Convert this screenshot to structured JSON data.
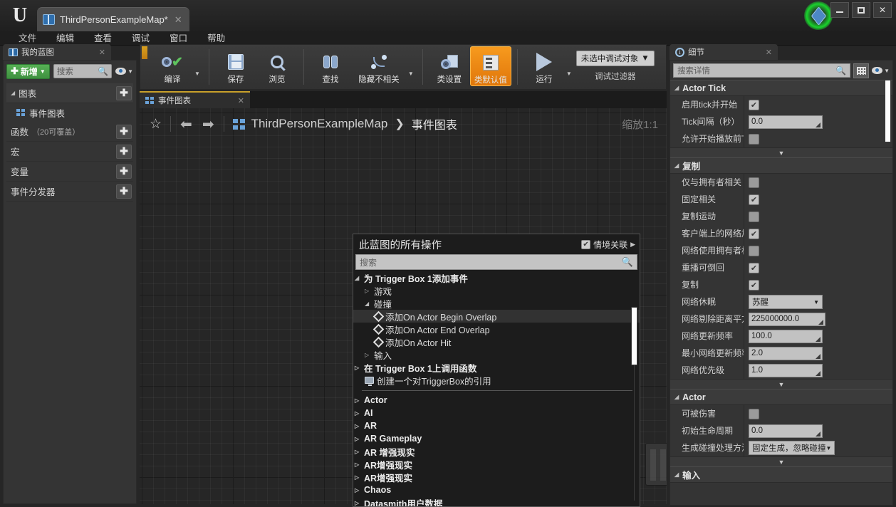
{
  "window": {
    "document_tab": "ThirdPersonExampleMap*",
    "minimize": "–",
    "maximize": "□",
    "close": "✕"
  },
  "menubar": [
    "文件",
    "编辑",
    "查看",
    "调试",
    "窗口",
    "帮助"
  ],
  "my_blueprint": {
    "tab_label": "我的蓝图",
    "add_button": "新增",
    "search_placeholder": "搜索",
    "sections": [
      {
        "label": "图表",
        "sub": "",
        "has_add": true
      },
      {
        "label": "函数",
        "sub": "（20可覆盖）",
        "has_add": true
      },
      {
        "label": "宏",
        "sub": "",
        "has_add": true
      },
      {
        "label": "变量",
        "sub": "",
        "has_add": true
      },
      {
        "label": "事件分发器",
        "sub": "",
        "has_add": true
      }
    ],
    "graph_child": "事件图表"
  },
  "toolbar": {
    "compile": "编译",
    "save": "保存",
    "browse": "浏览",
    "find": "查找",
    "hide_unrelated": "隐藏不相关",
    "class_settings": "类设置",
    "class_defaults": "类默认值",
    "play": "运行",
    "debug_target": "未选中调试对象",
    "debug_filter": "调试过滤器"
  },
  "graph": {
    "tab_label": "事件图表",
    "breadcrumb_root": "ThirdPersonExampleMap",
    "breadcrumb_sep": "❯",
    "breadcrumb_current": "事件图表",
    "zoom_label": "缩放1:1"
  },
  "context_menu": {
    "title": "此蓝图的所有操作",
    "context_sensitive": "情境关联",
    "search_placeholder": "搜索",
    "items": [
      {
        "label": "为 Trigger Box 1添加事件",
        "level": 0,
        "marker": "open",
        "bold": true
      },
      {
        "label": "游戏",
        "level": 1,
        "marker": "closed"
      },
      {
        "label": "碰撞",
        "level": 1,
        "marker": "open"
      },
      {
        "label": "添加On Actor Begin Overlap",
        "level": 2,
        "marker": "diamond",
        "selected": true
      },
      {
        "label": "添加On Actor End Overlap",
        "level": 2,
        "marker": "diamond"
      },
      {
        "label": "添加On Actor Hit",
        "level": 2,
        "marker": "diamond"
      },
      {
        "label": "输入",
        "level": 1,
        "marker": "closed"
      },
      {
        "label": "在 Trigger Box 1上调用函数",
        "level": 0,
        "marker": "closed",
        "bold": true
      },
      {
        "label": "创建一个对TriggerBox的引用",
        "level": 1,
        "marker": "monitor"
      },
      {
        "label": "Actor",
        "level": 0,
        "marker": "closed",
        "bold": true
      },
      {
        "label": "AI",
        "level": 0,
        "marker": "closed",
        "bold": true
      },
      {
        "label": "AR",
        "level": 0,
        "marker": "closed",
        "bold": true
      },
      {
        "label": "AR Gameplay",
        "level": 0,
        "marker": "closed",
        "bold": true
      },
      {
        "label": "AR 增强现实",
        "level": 0,
        "marker": "closed",
        "bold": true
      },
      {
        "label": "AR增强现实",
        "level": 0,
        "marker": "closed",
        "bold": true
      },
      {
        "label": "AR增强现实",
        "level": 0,
        "marker": "closed",
        "bold": true
      },
      {
        "label": "Chaos",
        "level": 0,
        "marker": "closed",
        "bold": true
      },
      {
        "label": "Datasmith用户数据",
        "level": 0,
        "marker": "closed",
        "bold": true
      }
    ]
  },
  "details": {
    "tab_label": "细节",
    "search_placeholder": "搜索详情",
    "categories": [
      {
        "name": "Actor Tick",
        "rows": [
          {
            "label": "启用tick并开始",
            "type": "checkbox",
            "value": true
          },
          {
            "label": "Tick间隔（秒）",
            "type": "number",
            "value": "0.0"
          },
          {
            "label": "允许开始播放前T",
            "type": "checkbox",
            "value": false
          }
        ],
        "collapsed_after": true
      },
      {
        "name": "复制",
        "rows": [
          {
            "label": "仅与拥有者相关",
            "type": "checkbox",
            "value": false
          },
          {
            "label": "固定相关",
            "type": "checkbox",
            "value": true
          },
          {
            "label": "复制运动",
            "type": "checkbox",
            "value": false
          },
          {
            "label": "客户端上的网络加",
            "type": "checkbox",
            "value": true
          },
          {
            "label": "网络使用拥有者相",
            "type": "checkbox",
            "value": false
          },
          {
            "label": "重播可倒回",
            "type": "checkbox",
            "value": true
          },
          {
            "label": "复制",
            "type": "checkbox",
            "value": true
          },
          {
            "label": "网络休眠",
            "type": "select",
            "value": "苏醒"
          },
          {
            "label": "网络剔除距离平方",
            "type": "number",
            "value": "225000000.0"
          },
          {
            "label": "网络更新频率",
            "type": "number",
            "value": "100.0"
          },
          {
            "label": "最小网络更新频率",
            "type": "number",
            "value": "2.0"
          },
          {
            "label": "网络优先级",
            "type": "number",
            "value": "1.0"
          }
        ],
        "collapsed_after": true
      },
      {
        "name": "Actor",
        "rows": [
          {
            "label": "可被伤害",
            "type": "checkbox",
            "value": false
          },
          {
            "label": "初始生命周期",
            "type": "number",
            "value": "0.0"
          },
          {
            "label": "生成碰撞处理方法",
            "type": "select",
            "value": "固定生成，忽略碰撞"
          }
        ],
        "collapsed_after": true
      },
      {
        "name": "输入",
        "rows": [],
        "collapsed_after": false
      }
    ]
  }
}
